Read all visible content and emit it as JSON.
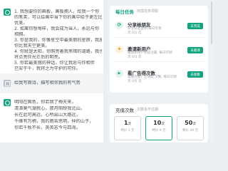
{
  "chat": {
    "reply1_lines": [
      "1. 我想要你的画板，画板拥人，给我一个你",
      "的笔笑，可以绘画中当下你的画中给于更左比",
      "优美。",
      "2. 如果你想每样，我会成为当人，永远与你",
      "相拥。",
      "3. 你是我的，你像星空中最美丽的星辰，我愿",
      "你比我天空更美。",
      "4. 你就是太阳，你照亮着我黑暗的道路，我也",
      "将点亮你光芒后的明亮。",
      "5. 你若最美丽的神话，你让我愿与你相伴",
      "已安于千，我将之为守护的可你。"
    ],
    "prompt_line": "给我写首诗，描写相邻我的有气势",
    "reply2_lines": [
      "明阳在国色，你若我了梅天来，",
      "清潭莫气潮我心，那月照映我北山。",
      "长在此可高远，心所出山大路远，",
      "千峰有万柄，我的雨苦思明，仲的山子，",
      "你若千秋不长，英英志今与四海。"
    ]
  },
  "daily_tasks": {
    "title": "每日任务",
    "subtitle": "完成任务领取",
    "tasks": [
      {
        "icon": "share-icon",
        "glyph": "⟳",
        "color": "#12a37f",
        "bg": "#e3f4ee",
        "title": "分享给朋友",
        "desc": "分享好友复制,每日可领\n次 0/1 次",
        "button": "去完成"
      },
      {
        "icon": "invite-icon",
        "glyph": "✦",
        "color": "#d99a1c",
        "bg": "#fbf1dc",
        "title": "邀请新用户",
        "desc": "邀请新用户完成注册, 每日可领\n次 0/3 次",
        "button": "去邀请"
      },
      {
        "icon": "ad-icon",
        "glyph": "▶",
        "color": "#12a37f",
        "bg": "#e3f4ee",
        "title": "看广告得次数",
        "desc": "观看完整广告领取 次数, 每日可领\n次 0/5 次",
        "button": "去观看"
      }
    ]
  },
  "package": {
    "title": "充值次数",
    "subtitle": "次数永不过期",
    "plans": [
      {
        "count": "1",
        "unit": "次",
        "price": "特价 1 元"
      },
      {
        "count": "10",
        "unit": "次",
        "price": "特价 9 元"
      },
      {
        "count": "50",
        "unit": "次",
        "price": "特价 39 元"
      }
    ],
    "active_index": 1
  }
}
